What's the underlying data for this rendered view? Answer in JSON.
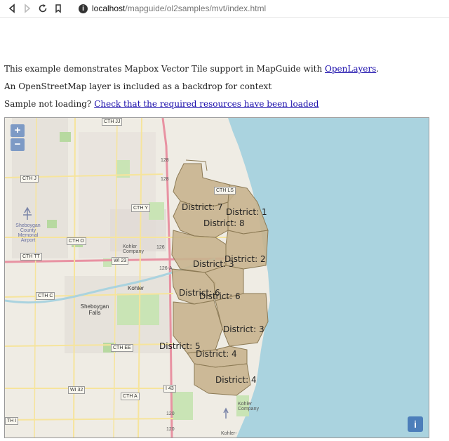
{
  "browser": {
    "host": "localhost",
    "path": "/mapguide/ol2samples/mvt/index.html"
  },
  "content": {
    "intro_text": "This example demonstrates Mapbox Vector Tile support in MapGuide with ",
    "intro_link": "OpenLayers",
    "intro_end": ".",
    "osm_text": "An OpenStreetMap layer is included as a backdrop for context",
    "sample_text": "Sample not loading? ",
    "sample_link": "Check that the required resources have been loaded"
  },
  "map": {
    "zoom_in": "+",
    "zoom_out": "−",
    "info": "i",
    "districts": [
      "District: 7",
      "District: 1",
      "District: 8",
      "District: 2",
      "District: 3",
      "District: 6",
      "District: 6",
      "District: 3",
      "District: 5",
      "District: 4",
      "District: 4"
    ],
    "roads": [
      "CTH JJ",
      "CTH J",
      "CTH Y",
      "CTH O",
      "CTH TT",
      "WI 23",
      "CTH C",
      "CTH EE",
      "WI 32",
      "CTH A",
      "I 43",
      "CTH LS",
      "TH I"
    ],
    "road_numbers": [
      "128",
      "128",
      "126",
      "126-A",
      "120",
      "120"
    ],
    "places": [
      "Sheboygan County Memorial Airport",
      "Kohler Company",
      "Kohler",
      "Sheboygan Falls",
      "Kohler Company",
      "Kohler-"
    ],
    "colors": {
      "water": "#aad3df",
      "district_fill": "#c8b48e",
      "district_stroke": "#8c7a55",
      "land": "#efece4",
      "park": "#c9e4b5"
    }
  }
}
